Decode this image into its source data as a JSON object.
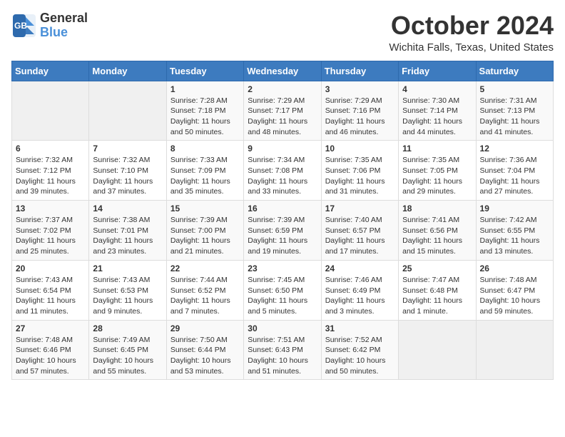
{
  "header": {
    "logo_general": "General",
    "logo_blue": "Blue",
    "month_title": "October 2024",
    "location": "Wichita Falls, Texas, United States"
  },
  "days_of_week": [
    "Sunday",
    "Monday",
    "Tuesday",
    "Wednesday",
    "Thursday",
    "Friday",
    "Saturday"
  ],
  "weeks": [
    [
      {
        "day": "",
        "sunrise": "",
        "sunset": "",
        "daylight": ""
      },
      {
        "day": "",
        "sunrise": "",
        "sunset": "",
        "daylight": ""
      },
      {
        "day": "1",
        "sunrise": "Sunrise: 7:28 AM",
        "sunset": "Sunset: 7:18 PM",
        "daylight": "Daylight: 11 hours and 50 minutes."
      },
      {
        "day": "2",
        "sunrise": "Sunrise: 7:29 AM",
        "sunset": "Sunset: 7:17 PM",
        "daylight": "Daylight: 11 hours and 48 minutes."
      },
      {
        "day": "3",
        "sunrise": "Sunrise: 7:29 AM",
        "sunset": "Sunset: 7:16 PM",
        "daylight": "Daylight: 11 hours and 46 minutes."
      },
      {
        "day": "4",
        "sunrise": "Sunrise: 7:30 AM",
        "sunset": "Sunset: 7:14 PM",
        "daylight": "Daylight: 11 hours and 44 minutes."
      },
      {
        "day": "5",
        "sunrise": "Sunrise: 7:31 AM",
        "sunset": "Sunset: 7:13 PM",
        "daylight": "Daylight: 11 hours and 41 minutes."
      }
    ],
    [
      {
        "day": "6",
        "sunrise": "Sunrise: 7:32 AM",
        "sunset": "Sunset: 7:12 PM",
        "daylight": "Daylight: 11 hours and 39 minutes."
      },
      {
        "day": "7",
        "sunrise": "Sunrise: 7:32 AM",
        "sunset": "Sunset: 7:10 PM",
        "daylight": "Daylight: 11 hours and 37 minutes."
      },
      {
        "day": "8",
        "sunrise": "Sunrise: 7:33 AM",
        "sunset": "Sunset: 7:09 PM",
        "daylight": "Daylight: 11 hours and 35 minutes."
      },
      {
        "day": "9",
        "sunrise": "Sunrise: 7:34 AM",
        "sunset": "Sunset: 7:08 PM",
        "daylight": "Daylight: 11 hours and 33 minutes."
      },
      {
        "day": "10",
        "sunrise": "Sunrise: 7:35 AM",
        "sunset": "Sunset: 7:06 PM",
        "daylight": "Daylight: 11 hours and 31 minutes."
      },
      {
        "day": "11",
        "sunrise": "Sunrise: 7:35 AM",
        "sunset": "Sunset: 7:05 PM",
        "daylight": "Daylight: 11 hours and 29 minutes."
      },
      {
        "day": "12",
        "sunrise": "Sunrise: 7:36 AM",
        "sunset": "Sunset: 7:04 PM",
        "daylight": "Daylight: 11 hours and 27 minutes."
      }
    ],
    [
      {
        "day": "13",
        "sunrise": "Sunrise: 7:37 AM",
        "sunset": "Sunset: 7:02 PM",
        "daylight": "Daylight: 11 hours and 25 minutes."
      },
      {
        "day": "14",
        "sunrise": "Sunrise: 7:38 AM",
        "sunset": "Sunset: 7:01 PM",
        "daylight": "Daylight: 11 hours and 23 minutes."
      },
      {
        "day": "15",
        "sunrise": "Sunrise: 7:39 AM",
        "sunset": "Sunset: 7:00 PM",
        "daylight": "Daylight: 11 hours and 21 minutes."
      },
      {
        "day": "16",
        "sunrise": "Sunrise: 7:39 AM",
        "sunset": "Sunset: 6:59 PM",
        "daylight": "Daylight: 11 hours and 19 minutes."
      },
      {
        "day": "17",
        "sunrise": "Sunrise: 7:40 AM",
        "sunset": "Sunset: 6:57 PM",
        "daylight": "Daylight: 11 hours and 17 minutes."
      },
      {
        "day": "18",
        "sunrise": "Sunrise: 7:41 AM",
        "sunset": "Sunset: 6:56 PM",
        "daylight": "Daylight: 11 hours and 15 minutes."
      },
      {
        "day": "19",
        "sunrise": "Sunrise: 7:42 AM",
        "sunset": "Sunset: 6:55 PM",
        "daylight": "Daylight: 11 hours and 13 minutes."
      }
    ],
    [
      {
        "day": "20",
        "sunrise": "Sunrise: 7:43 AM",
        "sunset": "Sunset: 6:54 PM",
        "daylight": "Daylight: 11 hours and 11 minutes."
      },
      {
        "day": "21",
        "sunrise": "Sunrise: 7:43 AM",
        "sunset": "Sunset: 6:53 PM",
        "daylight": "Daylight: 11 hours and 9 minutes."
      },
      {
        "day": "22",
        "sunrise": "Sunrise: 7:44 AM",
        "sunset": "Sunset: 6:52 PM",
        "daylight": "Daylight: 11 hours and 7 minutes."
      },
      {
        "day": "23",
        "sunrise": "Sunrise: 7:45 AM",
        "sunset": "Sunset: 6:50 PM",
        "daylight": "Daylight: 11 hours and 5 minutes."
      },
      {
        "day": "24",
        "sunrise": "Sunrise: 7:46 AM",
        "sunset": "Sunset: 6:49 PM",
        "daylight": "Daylight: 11 hours and 3 minutes."
      },
      {
        "day": "25",
        "sunrise": "Sunrise: 7:47 AM",
        "sunset": "Sunset: 6:48 PM",
        "daylight": "Daylight: 11 hours and 1 minute."
      },
      {
        "day": "26",
        "sunrise": "Sunrise: 7:48 AM",
        "sunset": "Sunset: 6:47 PM",
        "daylight": "Daylight: 10 hours and 59 minutes."
      }
    ],
    [
      {
        "day": "27",
        "sunrise": "Sunrise: 7:48 AM",
        "sunset": "Sunset: 6:46 PM",
        "daylight": "Daylight: 10 hours and 57 minutes."
      },
      {
        "day": "28",
        "sunrise": "Sunrise: 7:49 AM",
        "sunset": "Sunset: 6:45 PM",
        "daylight": "Daylight: 10 hours and 55 minutes."
      },
      {
        "day": "29",
        "sunrise": "Sunrise: 7:50 AM",
        "sunset": "Sunset: 6:44 PM",
        "daylight": "Daylight: 10 hours and 53 minutes."
      },
      {
        "day": "30",
        "sunrise": "Sunrise: 7:51 AM",
        "sunset": "Sunset: 6:43 PM",
        "daylight": "Daylight: 10 hours and 51 minutes."
      },
      {
        "day": "31",
        "sunrise": "Sunrise: 7:52 AM",
        "sunset": "Sunset: 6:42 PM",
        "daylight": "Daylight: 10 hours and 50 minutes."
      },
      {
        "day": "",
        "sunrise": "",
        "sunset": "",
        "daylight": ""
      },
      {
        "day": "",
        "sunrise": "",
        "sunset": "",
        "daylight": ""
      }
    ]
  ]
}
